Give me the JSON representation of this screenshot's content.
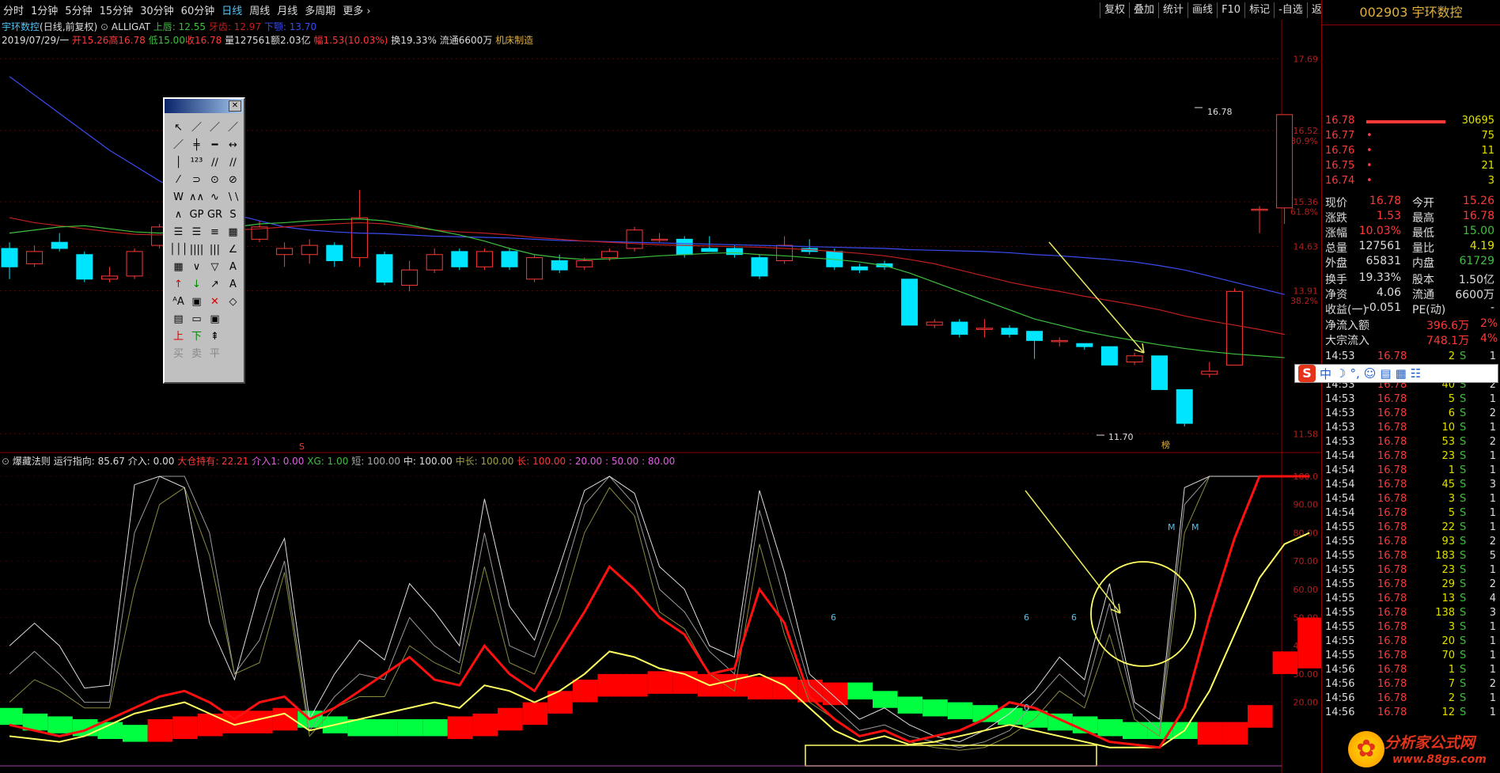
{
  "menu": {
    "items": [
      "分时",
      "1分钟",
      "5分钟",
      "15分钟",
      "30分钟",
      "60分钟",
      "日线",
      "周线",
      "月线",
      "多周期"
    ],
    "active": "日线",
    "more": "更多"
  },
  "toolbar": [
    "复权",
    "叠加",
    "统计",
    "画线",
    "F10",
    "标记",
    "-自选",
    "返回"
  ],
  "stockinfo": {
    "name": "宇环数控",
    "period": "(日线,前复权)",
    "alligat_label": "ALLIGAT",
    "upper_lip": "上唇: 12.55",
    "teeth": "牙齿: 12.97",
    "lower_jaw": "下颚: 13.70"
  },
  "quote": {
    "date": "2019/07/29/一",
    "open": "开15.26",
    "high": "高16.78",
    "low": "低15.00",
    "close": "收16.78",
    "volume": "量127561",
    "amount": "额2.03亿",
    "change": "幅1.53(10.03%)",
    "turnover": "换19.33%",
    "float": "流通6600万",
    "industry": "机床制造"
  },
  "indicator": {
    "name": "爆藏法则",
    "run": "运行指向: 85.67",
    "entry": "介入: 0.00",
    "hold": "大仓持有: 22.21",
    "entry1": "介入1: 0.00",
    "xg": "XG: 1.00",
    "short": "短: 100.00",
    "mid": "中: 100.00",
    "midlong": "中长: 100.00",
    "long": "长: 100.00",
    "l20": ": 20.00",
    "l50": ": 50.00",
    "l80": ": 80.00"
  },
  "price_axis": [
    "17.69",
    "16.52",
    "80.9%",
    "15.36",
    "61.8%",
    "14.63",
    "13.91",
    "38.2%",
    "11.58"
  ],
  "ind_axis": [
    "100.0",
    "90.00",
    "80.00",
    "70.00",
    "60.00",
    "50.00",
    "40.00",
    "30.00",
    "20.00"
  ],
  "annotations": {
    "high": "16.78",
    "low": "11.70",
    "m1": "M",
    "m2": "M",
    "six1": "6",
    "six2": "6",
    "six3": "6",
    "zero": "0",
    "s_marker": "S",
    "bang": "榜"
  },
  "right_panel": {
    "code": "002903",
    "name": "宇环数控",
    "orderbook": [
      {
        "price": "16.78",
        "vol": "30695"
      },
      {
        "price": "16.77",
        "vol": "75"
      },
      {
        "price": "16.76",
        "vol": "11"
      },
      {
        "price": "16.75",
        "vol": "21"
      },
      {
        "price": "16.74",
        "vol": "3"
      }
    ],
    "quotes": [
      {
        "l1": "现价",
        "v1": "16.78",
        "l2": "今开",
        "v2": "15.26"
      },
      {
        "l1": "涨跌",
        "v1": "1.53",
        "l2": "最高",
        "v2": "16.78"
      },
      {
        "l1": "涨幅",
        "v1": "10.03%",
        "l2": "最低",
        "v2": "15.00"
      },
      {
        "l1": "总量",
        "v1": "127561",
        "l2": "量比",
        "v2": "4.19"
      },
      {
        "l1": "外盘",
        "v1": "65831",
        "l2": "内盘",
        "v2": "61729"
      },
      {
        "l1": "换手",
        "v1": "19.33%",
        "l2": "股本",
        "v2": "1.50亿"
      },
      {
        "l1": "净资",
        "v1": "4.06",
        "l2": "流通",
        "v2": "6600万"
      },
      {
        "l1": "收益(一)",
        "v1": "-0.051",
        "l2": "PE(动)",
        "v2": "-"
      }
    ],
    "netflow": {
      "l": "净流入额",
      "v": "396.6万",
      "p": "2%"
    },
    "bigflow": {
      "l": "大宗流入",
      "v": "748.1万",
      "p": "4%"
    },
    "ticks": [
      {
        "t": "14:53",
        "p": "16.78",
        "v": "2",
        "s": "S",
        "n": "1"
      },
      {
        "t": "14:53",
        "p": "16.78",
        "v": "1",
        "s": "S",
        "n": "1"
      },
      {
        "t": "14:53",
        "p": "16.78",
        "v": "40",
        "s": "S",
        "n": "2"
      },
      {
        "t": "14:53",
        "p": "16.78",
        "v": "5",
        "s": "S",
        "n": "1"
      },
      {
        "t": "14:53",
        "p": "16.78",
        "v": "6",
        "s": "S",
        "n": "2"
      },
      {
        "t": "14:53",
        "p": "16.78",
        "v": "10",
        "s": "S",
        "n": "1"
      },
      {
        "t": "14:53",
        "p": "16.78",
        "v": "53",
        "s": "S",
        "n": "2"
      },
      {
        "t": "14:54",
        "p": "16.78",
        "v": "23",
        "s": "S",
        "n": "1"
      },
      {
        "t": "14:54",
        "p": "16.78",
        "v": "1",
        "s": "S",
        "n": "1"
      },
      {
        "t": "14:54",
        "p": "16.78",
        "v": "45",
        "s": "S",
        "n": "3"
      },
      {
        "t": "14:54",
        "p": "16.78",
        "v": "3",
        "s": "S",
        "n": "1"
      },
      {
        "t": "14:54",
        "p": "16.78",
        "v": "5",
        "s": "S",
        "n": "1"
      },
      {
        "t": "14:55",
        "p": "16.78",
        "v": "22",
        "s": "S",
        "n": "1"
      },
      {
        "t": "14:55",
        "p": "16.78",
        "v": "93",
        "s": "S",
        "n": "2"
      },
      {
        "t": "14:55",
        "p": "16.78",
        "v": "183",
        "s": "S",
        "n": "5"
      },
      {
        "t": "14:55",
        "p": "16.78",
        "v": "23",
        "s": "S",
        "n": "1"
      },
      {
        "t": "14:55",
        "p": "16.78",
        "v": "29",
        "s": "S",
        "n": "2"
      },
      {
        "t": "14:55",
        "p": "16.78",
        "v": "13",
        "s": "S",
        "n": "4"
      },
      {
        "t": "14:55",
        "p": "16.78",
        "v": "138",
        "s": "S",
        "n": "3"
      },
      {
        "t": "14:55",
        "p": "16.78",
        "v": "3",
        "s": "S",
        "n": "1"
      },
      {
        "t": "14:55",
        "p": "16.78",
        "v": "20",
        "s": "S",
        "n": "1"
      },
      {
        "t": "14:55",
        "p": "16.78",
        "v": "70",
        "s": "S",
        "n": "1"
      },
      {
        "t": "14:56",
        "p": "16.78",
        "v": "1",
        "s": "S",
        "n": "1"
      },
      {
        "t": "14:56",
        "p": "16.78",
        "v": "7",
        "s": "S",
        "n": "2"
      },
      {
        "t": "14:56",
        "p": "16.78",
        "v": "2",
        "s": "S",
        "n": "1"
      },
      {
        "t": "14:56",
        "p": "16.78",
        "v": "12",
        "s": "S",
        "n": "1"
      }
    ]
  },
  "ime": {
    "s": "S",
    "zh": "中",
    "moon": "☽",
    "dot": "°,",
    "smile": "☺",
    "keyboard": "▤",
    "grid": "▦",
    "mgr": "☷"
  },
  "logo": {
    "text": "分析家公式网",
    "url": "www.88gs.com"
  },
  "tools": [
    "↖",
    "／",
    "／",
    "／",
    "／",
    "╪",
    "━",
    "↔",
    "│",
    "¹²³",
    "∕∕",
    "∕∕",
    "⁄",
    "⊃",
    "⊙",
    "⊘",
    "W",
    "∧∧",
    "∿",
    "∖∖",
    "∧",
    "GP",
    "GR",
    "S",
    "☰",
    "☰",
    "≡",
    "▦",
    "│││",
    "||||",
    "|||",
    "∠",
    "▦",
    "∨",
    "▽",
    "A",
    "↑",
    "↓",
    "↗",
    "A",
    "ᴬA",
    "▣",
    "✕",
    "◇",
    "▤",
    "▭",
    "▣",
    "",
    "上",
    "下",
    "⇞",
    "",
    "买",
    "卖",
    "平",
    ""
  ],
  "colors": {
    "up": "#ff3838",
    "down": "#00e5ff",
    "ma_blue": "#3b4cf0",
    "ma_red": "#c0201e",
    "ma_green": "#3fbf3f",
    "yellow": "#ffff60",
    "green": "#00ff40"
  }
}
